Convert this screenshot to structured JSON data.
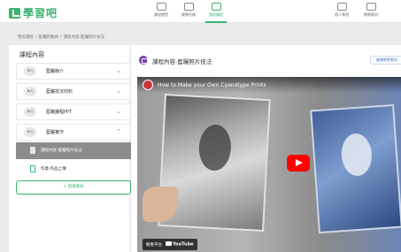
{
  "app": {
    "logo_text": "學習吧",
    "brand_color": "#3cb371"
  },
  "nav": {
    "items": [
      {
        "label": "課程總覽",
        "icon": "book-icon",
        "active": false
      },
      {
        "label": "教學任務",
        "icon": "task-icon",
        "active": false
      },
      {
        "label": "我的課程",
        "icon": "my-course-icon",
        "active": true
      },
      {
        "label": "個人學習",
        "icon": "person-icon",
        "active": false
      },
      {
        "label": "教學素材",
        "icon": "material-icon",
        "active": false
      }
    ]
  },
  "breadcrumb": {
    "items": [
      "我的課程",
      "藍曬新藝術",
      "課程內容-藍曬照片技法"
    ]
  },
  "sidebar": {
    "title": "課程內容",
    "sections": [
      {
        "badge": "單元",
        "label": "藍曬簡介",
        "icon": "chevron-down-icon"
      },
      {
        "badge": "單元",
        "label": "藍曬技法材料",
        "icon": "chevron-down-icon"
      },
      {
        "badge": "單元",
        "label": "藍曬課程PPT",
        "icon": "chevron-down-icon"
      },
      {
        "badge": "單元",
        "label": "藍曬實作",
        "icon": "chevron-up-icon"
      }
    ],
    "sub_items": [
      {
        "label": "課程內容-藍曬照片技法",
        "active": true,
        "icon": "video-doc-icon"
      },
      {
        "label": "作業-作品上傳",
        "active": false,
        "icon": "assignment-icon"
      }
    ],
    "add_button_label": "+ 新增素材"
  },
  "content": {
    "title": "課程內容-藍曬照片技法",
    "edit_button_label": "編輯教學素材",
    "video": {
      "title": "How to Make your Own Cyanotype Prints",
      "watch_label": "觀看平台",
      "platform": "YouTube",
      "accent_color": "#ff0000"
    }
  }
}
